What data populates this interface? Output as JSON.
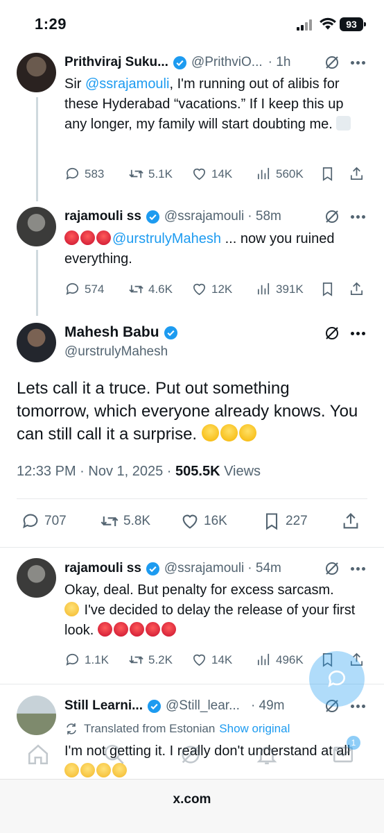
{
  "status_bar": {
    "time": "1:29",
    "battery": "93"
  },
  "tweets": [
    {
      "name": "Prithviraj Suku...",
      "handle": "@PrithviO...",
      "time": "· 1h",
      "text_pre": "Sir ",
      "mention": "@ssrajamouli",
      "text_post": ", I'm running out of alibis for these Hyderabad “vacations.” If I keep this up any longer, my family will start doubting me.",
      "replies": "583",
      "reposts": "5.1K",
      "likes": "14K",
      "views": "560K"
    },
    {
      "name": "rajamouli ss",
      "handle": "@ssrajamouli",
      "time": "· 58m",
      "mention": "@urstrulyMahesh",
      "text_post": " ... now you ruined everything.",
      "replies": "574",
      "reposts": "4.6K",
      "likes": "12K",
      "views": "391K"
    },
    {
      "name": "rajamouli ss",
      "handle": "@ssrajamouli",
      "time": "· 54m",
      "text_line1": "Okay, deal. But penalty for excess sarcasm.",
      "text_line2": " I've decided  to delay the release of your first look. ",
      "replies": "1.1K",
      "reposts": "5.2K",
      "likes": "14K",
      "views": "496K"
    },
    {
      "name": "Still Learni...",
      "handle": "@Still_lear...",
      "time": "· 49m",
      "translated_label": "Translated from Estonian",
      "show_original": "Show original",
      "text": "I'm not getting it. I really don't understand at all "
    }
  ],
  "main_tweet": {
    "name": "Mahesh Babu",
    "handle": "@urstrulyMahesh",
    "text": "Lets call it a truce. Put out something tomorrow, which everyone already knows. You can still call it a surprise. ",
    "time": "12:33 PM · Nov 1, 2025 · ",
    "views_count": "505.5K",
    "views_label": " Views",
    "replies": "707",
    "reposts": "5.8K",
    "likes": "16K",
    "bookmarks": "227"
  },
  "nav": {
    "badge": "1"
  },
  "browser": {
    "url": "x.com"
  },
  "colors": {
    "accent": "#1d9bf0",
    "text": "#0f1419",
    "muted": "#536471"
  }
}
